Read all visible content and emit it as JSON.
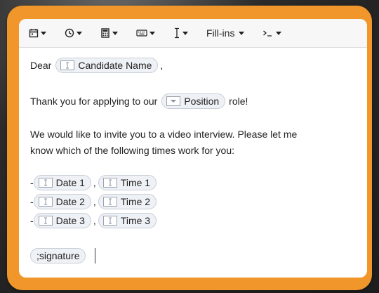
{
  "toolbar": {
    "items": [
      {
        "icon": "calendar-icon"
      },
      {
        "icon": "clock-icon"
      },
      {
        "icon": "calculator-icon"
      },
      {
        "icon": "keyboard-icon"
      },
      {
        "icon": "text-cursor-icon"
      },
      {
        "label": "Fill-ins"
      },
      {
        "icon": "terminal-prompt-icon"
      }
    ],
    "fillins_label": "Fill-ins"
  },
  "body": {
    "greeting": "Dear",
    "greeting_field": "Candidate Name",
    "greeting_end": ",",
    "line2_before": "Thank you for applying to our",
    "line2_field": "Position",
    "line2_after": "role!",
    "para3_line1": "We would like to invite you to a video interview. Please let me",
    "para3_line2": "know which of the following times work for you:",
    "slots": [
      {
        "dash": "-",
        "date": "Date 1",
        "sep": ",",
        "time": "Time 1"
      },
      {
        "dash": "-",
        "date": "Date 2",
        "sep": ",",
        "time": "Time 2"
      },
      {
        "dash": "-",
        "date": "Date 3",
        "sep": ",",
        "time": "Time 3"
      }
    ],
    "signature": ";signature"
  },
  "colors": {
    "frame": "#f0962a",
    "chip_bg": "#eef1f6",
    "chip_border": "#c9ced6"
  }
}
